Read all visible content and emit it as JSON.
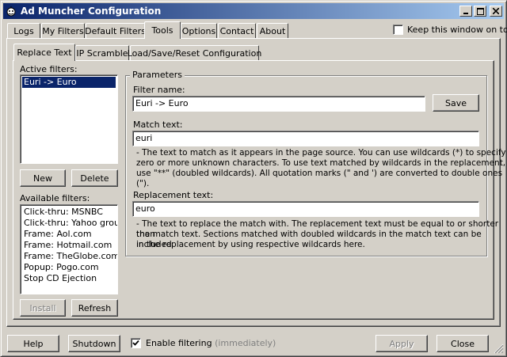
{
  "window": {
    "title": "Ad Muncher Configuration"
  },
  "titlebar": {
    "minimize": "_",
    "maximize": "□",
    "close": "×"
  },
  "main_tabs": [
    {
      "label": "Logs"
    },
    {
      "label": "My Filters"
    },
    {
      "label": "Default Filters"
    },
    {
      "label": "Tools"
    },
    {
      "label": "Options"
    },
    {
      "label": "Contact"
    },
    {
      "label": "About"
    }
  ],
  "keep_on_top": {
    "label": "Keep this window on top",
    "checked": false
  },
  "sub_tabs": [
    {
      "label": "Replace Text"
    },
    {
      "label": "IP Scramble"
    },
    {
      "label": "Load/Save/Reset Configuration"
    }
  ],
  "active_filters": {
    "label": "Active filters:",
    "items": [
      "Euri -> Euro"
    ],
    "selected": 0
  },
  "buttons": {
    "new": "New",
    "delete": "Delete",
    "install": "Install",
    "refresh": "Refresh",
    "save": "Save",
    "help": "Help",
    "shutdown": "Shutdown",
    "apply": "Apply",
    "close": "Close"
  },
  "available_filters": {
    "label": "Available filters:",
    "items": [
      "Click-thru: MSNBC",
      "Click-thru: Yahoo groups",
      "Frame: Aol.com",
      "Frame: Hotmail.com",
      "Frame: TheGlobe.com",
      "Popup: Pogo.com",
      "Stop CD Ejection"
    ]
  },
  "parameters": {
    "title": "Parameters",
    "filter_name_label": "Filter name:",
    "filter_name_value": "Euri -> Euro",
    "match_text_label": "Match text:",
    "match_text_value": "euri",
    "match_desc_1": "- The text to match as it appears in the page source.  You can use wildcards (*) to specify",
    "match_desc_2": "zero or more unknown characters.  To use text matched by wildcards in the replacement,",
    "match_desc_3": "use \"**\" (doubled wildcards).  All quotation marks (\" and ') are converted to double ones (\").",
    "replacement_label": "Replacement text:",
    "replacement_value": "euro",
    "replace_desc_1": "- The text to replace the match with.  The replacement text must be equal to or shorter than",
    "replace_desc_2": "the match text.  Sections matched with doubled wildcards in the match text can be included",
    "replace_desc_3": "in the replacement by using respective wildcards here."
  },
  "footer": {
    "enable_filtering_label": "Enable filtering",
    "enable_filtering_note": "(immediately)",
    "enable_filtering_checked": true
  }
}
